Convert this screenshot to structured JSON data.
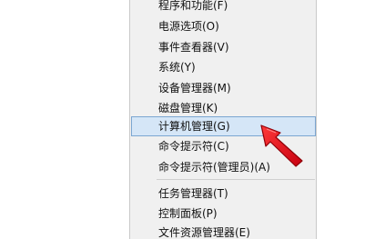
{
  "menu": {
    "items": [
      {
        "label": "程序和功能(F)",
        "selected": false
      },
      {
        "label": "电源选项(O)",
        "selected": false
      },
      {
        "label": "事件查看器(V)",
        "selected": false
      },
      {
        "label": "系统(Y)",
        "selected": false
      },
      {
        "label": "设备管理器(M)",
        "selected": false
      },
      {
        "label": "磁盘管理(K)",
        "selected": false
      },
      {
        "label": "计算机管理(G)",
        "selected": true
      },
      {
        "label": "命令提示符(C)",
        "selected": false
      },
      {
        "label": "命令提示符(管理员)(A)",
        "selected": false
      },
      {
        "label": "任务管理器(T)",
        "selected": false
      },
      {
        "label": "控制面板(P)",
        "selected": false
      },
      {
        "label": "文件资源管理器(E)",
        "selected": false
      }
    ]
  },
  "colors": {
    "menu_background": "#f0f0f0",
    "selected_background": "#d5e6f7",
    "selected_border": "#7ba6d1",
    "annotation_arrow": "#e0101a"
  },
  "annotation": {
    "icon": "red-pointer-arrow-icon"
  }
}
